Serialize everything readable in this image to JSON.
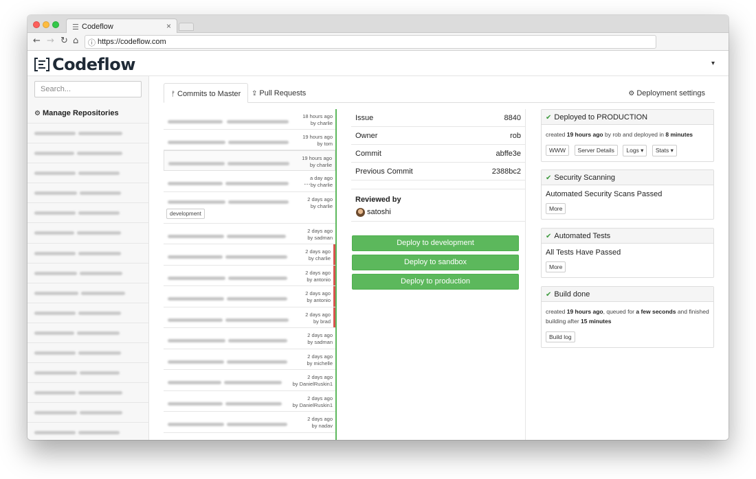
{
  "browser": {
    "tab_title": "Codeflow",
    "tab_close": "×",
    "url": "https://codeflow.com",
    "icons": {
      "back": "arrow-left-icon",
      "forward": "arrow-right-icon",
      "reload": "reload-icon",
      "home": "home-icon",
      "info": "info-icon"
    }
  },
  "header": {
    "logo_text": "Codeflow",
    "user_menu_caret": "▾"
  },
  "sidebar": {
    "search_placeholder": "Search...",
    "manage_label": "Manage Repositories"
  },
  "tabs": {
    "commits_label": "Commits to Master",
    "prs_label": "Pull Requests",
    "deploy_settings_label": "Deployment settings"
  },
  "commits": [
    {
      "time": "18 hours ago",
      "author": "by charlie"
    },
    {
      "time": "19 hours ago",
      "author": "by tom"
    },
    {
      "time": "19 hours ago",
      "author": "by charlie"
    },
    {
      "time": "a day ago",
      "author": "by charlie"
    },
    {
      "time": "2 days ago",
      "author": "by charlie",
      "branch": "development"
    },
    {
      "time": "2 days ago",
      "author": "by sadman"
    },
    {
      "time": "2 days ago",
      "author": "by charlie"
    },
    {
      "time": "2 days ago",
      "author": "by antonio"
    },
    {
      "time": "2 days ago",
      "author": "by antonio"
    },
    {
      "time": "2 days ago",
      "author": "by brad"
    },
    {
      "time": "2 days ago",
      "author": "by sadman"
    },
    {
      "time": "2 days ago",
      "author": "by michelle"
    },
    {
      "time": "2 days ago",
      "author": "by DanielRuskin1"
    },
    {
      "time": "2 days ago",
      "author": "by DanielRuskin1"
    },
    {
      "time": "2 days ago",
      "author": "by nadav"
    }
  ],
  "details": {
    "issue_label": "Issue",
    "issue_value": "8840",
    "owner_label": "Owner",
    "owner_value": "rob",
    "commit_label": "Commit",
    "commit_value": "abffe3e",
    "prev_commit_label": "Previous Commit",
    "prev_commit_value": "2388bc2",
    "reviewed_label": "Reviewed by",
    "reviewer": "satoshi"
  },
  "deploy_buttons": {
    "development": "Deploy to development",
    "sandbox": "Deploy to sandbox",
    "production": "Deploy to production"
  },
  "status": {
    "production": {
      "title": "Deployed to PRODUCTION",
      "line_created": "created ",
      "line_time": "19 hours ago",
      "line_by": " by rob and deployed in ",
      "line_duration": "8 minutes",
      "btn_www": "WWW",
      "btn_server": "Server Details",
      "btn_logs": "Logs ▾",
      "btn_stats": "Stats ▾"
    },
    "security": {
      "title": "Security Scanning",
      "text": "Automated Security Scans Passed",
      "btn_more": "More"
    },
    "tests": {
      "title": "Automated Tests",
      "text": "All Tests Have Passed",
      "btn_more": "More"
    },
    "build": {
      "title": "Build done",
      "p1": "created ",
      "p2": "19 hours ago",
      "p3": ", queued for ",
      "p4": "a few seconds",
      "p5": " and finished building after ",
      "p6": "15 minutes",
      "btn_log": "Build log"
    },
    "check_icon": "check-icon",
    "accent_green": "#5cb85c"
  }
}
